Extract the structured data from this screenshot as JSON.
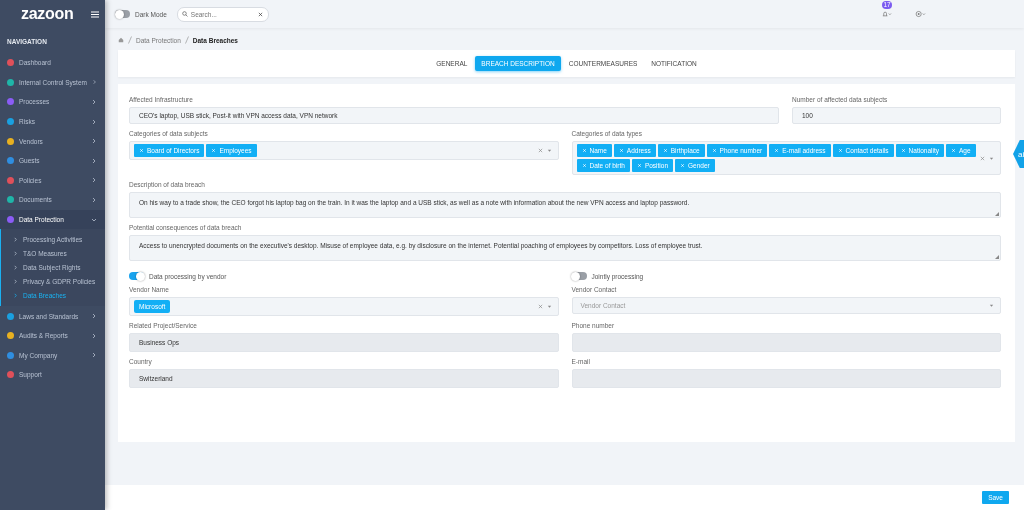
{
  "sidebar": {
    "logo": "zazoon",
    "section_title": "NAVIGATION",
    "items": [
      {
        "label": "Dashboard",
        "color": "#e0505a",
        "expandable": false,
        "expanded": false
      },
      {
        "label": "Internal Control System",
        "color": "#1fb5a8",
        "expandable": true,
        "expanded": false
      },
      {
        "label": "Processes",
        "color": "#8b5cf6",
        "expandable": true,
        "expanded": false
      },
      {
        "label": "Risks",
        "color": "#1aa0e0",
        "expandable": true,
        "expanded": false
      },
      {
        "label": "Vendors",
        "color": "#e8b020",
        "expandable": true,
        "expanded": false
      },
      {
        "label": "Guests",
        "color": "#2f8ee0",
        "expandable": true,
        "expanded": false
      },
      {
        "label": "Policies",
        "color": "#e0505a",
        "expandable": true,
        "expanded": false
      },
      {
        "label": "Documents",
        "color": "#1fb5a8",
        "expandable": true,
        "expanded": false
      },
      {
        "label": "Data Protection",
        "color": "#8b5cf6",
        "expandable": true,
        "expanded": true,
        "children": [
          {
            "label": "Processing Activities",
            "selected": false
          },
          {
            "label": "T&O Measures",
            "selected": false
          },
          {
            "label": "Data Subject Rights",
            "selected": false
          },
          {
            "label": "Privacy & GDPR Policies",
            "selected": false
          },
          {
            "label": "Data Breaches",
            "selected": true
          }
        ]
      },
      {
        "label": "Laws and Standards",
        "color": "#1aa0e0",
        "expandable": true,
        "expanded": false
      },
      {
        "label": "Audits & Reports",
        "color": "#e8b020",
        "expandable": true,
        "expanded": false
      },
      {
        "label": "My Company",
        "color": "#2f8ee0",
        "expandable": true,
        "expanded": false
      },
      {
        "label": "Support",
        "color": "#e0505a",
        "expandable": false,
        "expanded": false
      }
    ]
  },
  "topbar": {
    "dark_mode": {
      "label": "Dark Mode",
      "on": false
    },
    "search": {
      "placeholder": "Search..."
    },
    "notification_count": "17"
  },
  "breadcrumb": [
    "Data Protection",
    "Data Breaches"
  ],
  "tabs": [
    {
      "label": "GENERAL",
      "selected": false
    },
    {
      "label": "BREACH DESCRIPTION",
      "selected": true
    },
    {
      "label": "COUNTERMEASURES",
      "selected": false
    },
    {
      "label": "NOTIFICATION",
      "selected": false
    }
  ],
  "side_tab": "ai",
  "form": {
    "affected_infrastructure": {
      "label": "Affected Infrastructure",
      "value": "CEO's laptop, USB stick, Post-it with VPN access data, VPN network"
    },
    "affected_count": {
      "label": "Number of affected data subjects",
      "value": "100"
    },
    "categories": [
      {
        "label": "Categories of data subjects",
        "tags": [
          "Board of Directors",
          "Employees"
        ]
      },
      {
        "label": "Categories of data types",
        "tags": [
          "Name",
          "Address",
          "Birthplace",
          "Phone number",
          "E-mail address",
          "Contact details",
          "Nationality",
          "Age",
          "Date of birth",
          "Position",
          "Gender"
        ]
      }
    ],
    "texts": [
      {
        "label": "Description of data breach",
        "value": "On his way to a trade show, the CEO forgot his laptop bag on the train. In it was the laptop and a USB stick, as well as a note with information about the new VPN access and laptop password."
      },
      {
        "label": "Potential consequences of data breach",
        "value": "Access to unencrypted documents on the executive's desktop. Misuse of employee data, e.g. by disclosure on the internet. Potential poaching of employees by competitors. Loss of employee trust."
      }
    ],
    "toggles": [
      {
        "label": "Data processing by vendor",
        "on": true
      },
      {
        "label": "Jointly processing",
        "on": false
      }
    ],
    "vendor_fields": [
      {
        "kind": "tags",
        "label": "Vendor Name",
        "tags": [
          "Microsoft"
        ]
      },
      {
        "kind": "select",
        "label": "Vendor Contact",
        "placeholder": "Vendor Contact"
      },
      {
        "kind": "text",
        "label": "Related Project/Service",
        "value": "Business Ops",
        "disabled": true
      },
      {
        "kind": "text",
        "label": "Phone number",
        "disabled": true
      },
      {
        "kind": "text",
        "label": "Country",
        "value": "Switzerland",
        "disabled": true
      },
      {
        "kind": "text",
        "label": "E-mail",
        "disabled": true
      }
    ]
  },
  "footer": {
    "save": "Save"
  }
}
